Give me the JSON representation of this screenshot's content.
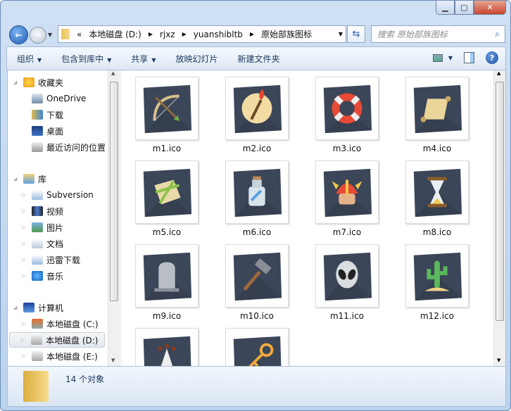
{
  "window": {
    "controls": [
      "minimize",
      "maximize",
      "close"
    ]
  },
  "address": {
    "overflow": "«",
    "crumbs": [
      "本地磁盘 (D:)",
      "rjxz",
      "yuanshibltb",
      "原始部族图标"
    ]
  },
  "search": {
    "placeholder": "搜索 原始部族图标"
  },
  "toolbar": {
    "items": [
      {
        "label": "组织",
        "dropdown": true
      },
      {
        "label": "包含到库中",
        "dropdown": true
      },
      {
        "label": "共享",
        "dropdown": true
      },
      {
        "label": "放映幻灯片",
        "dropdown": false
      },
      {
        "label": "新建文件夹",
        "dropdown": false
      }
    ]
  },
  "sidebar": {
    "groups": [
      {
        "label": "收藏夹",
        "icon": "star-icon",
        "items": [
          {
            "label": "OneDrive",
            "icon": "onedrive-icon"
          },
          {
            "label": "下载",
            "icon": "download-folder-icon"
          },
          {
            "label": "桌面",
            "icon": "desktop-icon"
          },
          {
            "label": "最近访问的位置",
            "icon": "recent-places-icon"
          }
        ]
      },
      {
        "label": "库",
        "icon": "library-icon",
        "items": [
          {
            "label": "Subversion",
            "icon": "library-doc-icon"
          },
          {
            "label": "视频",
            "icon": "video-icon"
          },
          {
            "label": "图片",
            "icon": "pictures-icon"
          },
          {
            "label": "文档",
            "icon": "documents-icon"
          },
          {
            "label": "迅雷下载",
            "icon": "library-doc-icon"
          },
          {
            "label": "音乐",
            "icon": "music-icon"
          }
        ]
      },
      {
        "label": "计算机",
        "icon": "computer-icon",
        "items": [
          {
            "label": "本地磁盘 (C:)",
            "icon": "system-drive-icon"
          },
          {
            "label": "本地磁盘 (D:)",
            "icon": "drive-icon",
            "selected": true
          },
          {
            "label": "本地磁盘 (E:)",
            "icon": "drive-icon"
          }
        ]
      }
    ]
  },
  "files": [
    {
      "name": "m1.ico",
      "icon": "bow-arrow"
    },
    {
      "name": "m2.ico",
      "icon": "torch"
    },
    {
      "name": "m3.ico",
      "icon": "lifebuoy"
    },
    {
      "name": "m4.ico",
      "icon": "scroll"
    },
    {
      "name": "m5.ico",
      "icon": "bundle"
    },
    {
      "name": "m6.ico",
      "icon": "bottle"
    },
    {
      "name": "m7.ico",
      "icon": "viking"
    },
    {
      "name": "m8.ico",
      "icon": "hourglass"
    },
    {
      "name": "m9.ico",
      "icon": "tombstone"
    },
    {
      "name": "m10.ico",
      "icon": "hammer"
    },
    {
      "name": "m11.ico",
      "icon": "alien"
    },
    {
      "name": "m12.ico",
      "icon": "cactus"
    },
    {
      "name": "",
      "icon": "matches"
    },
    {
      "name": "",
      "icon": "key"
    }
  ],
  "status": {
    "count": "14 个对象"
  },
  "colors": {
    "tile_bg": "#3b4658",
    "frame": "#bcd3ee"
  }
}
